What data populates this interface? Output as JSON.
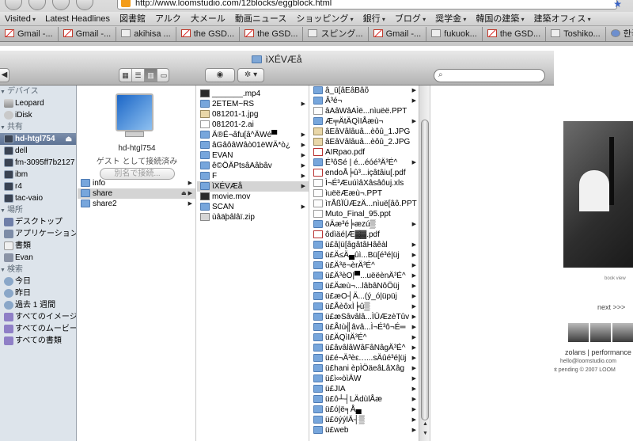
{
  "browser": {
    "url": "http://www.loomstudio.com/12blocks/eggblock.html",
    "bookmarks": [
      {
        "label": "Visited",
        "has_menu": true
      },
      {
        "label": "Latest Headlines",
        "has_menu": false
      },
      {
        "label": "図書館",
        "has_menu": false
      },
      {
        "label": "アルク",
        "has_menu": false
      },
      {
        "label": "大メール",
        "has_menu": false
      },
      {
        "label": "動画ニュース",
        "has_menu": false
      },
      {
        "label": "ショッピング",
        "has_menu": true
      },
      {
        "label": "銀行",
        "has_menu": true
      },
      {
        "label": "ブログ",
        "has_menu": true
      },
      {
        "label": "奨学金",
        "has_menu": true
      },
      {
        "label": "韓国の建築",
        "has_menu": true
      },
      {
        "label": "建築オフィス",
        "has_menu": true
      }
    ],
    "tabs": [
      {
        "label": "Gmail -...",
        "icon": "gmail-icon"
      },
      {
        "label": "Gmail -...",
        "icon": "gmail-icon"
      },
      {
        "label": "akihisa ...",
        "icon": "document-icon"
      },
      {
        "label": "the GSD...",
        "icon": "gmail-icon"
      },
      {
        "label": "the GSD...",
        "icon": "gmail-icon"
      },
      {
        "label": "スピング...",
        "icon": "document-icon"
      },
      {
        "label": "Gmail -...",
        "icon": "gmail-icon"
      },
      {
        "label": "fukuok...",
        "icon": "document-icon"
      },
      {
        "label": "the GSD...",
        "icon": "gmail-icon"
      },
      {
        "label": "Toshiko...",
        "icon": "document-icon"
      },
      {
        "label": "한국어",
        "icon": "globe-icon"
      }
    ]
  },
  "page": {
    "book_view": "book view",
    "next_link": "next >>>",
    "caption_line1": "zolans | performance",
    "caption_line2": "hello@loomstudio.com",
    "caption_line3": "nt pending © 2007 LOOM"
  },
  "finder": {
    "title": "ìXÉVÆå",
    "sidebar": {
      "sections": [
        {
          "heading": "デバイス",
          "items": [
            {
              "label": "Leopard",
              "icon": "hard-disk-icon",
              "selected": false
            },
            {
              "label": "iDisk",
              "icon": "idisk-icon",
              "selected": false
            }
          ]
        },
        {
          "heading": "共有",
          "items": [
            {
              "label": "hd-htgl754",
              "icon": "server-icon",
              "selected": true,
              "eject": true
            },
            {
              "label": "dell",
              "icon": "server-icon",
              "selected": false
            },
            {
              "label": "fm-3095ff7b2127",
              "icon": "server-icon",
              "selected": false
            },
            {
              "label": "ibm",
              "icon": "server-icon",
              "selected": false
            },
            {
              "label": "r4",
              "icon": "server-icon",
              "selected": false
            },
            {
              "label": "tac-vaio",
              "icon": "server-icon",
              "selected": false
            }
          ]
        },
        {
          "heading": "場所",
          "items": [
            {
              "label": "デスクトップ",
              "icon": "desktop-icon",
              "selected": false
            },
            {
              "label": "アプリケーション",
              "icon": "applications-icon",
              "selected": false
            },
            {
              "label": "書類",
              "icon": "documents-icon",
              "selected": false
            },
            {
              "label": "Evan",
              "icon": "home-icon",
              "selected": false
            }
          ]
        },
        {
          "heading": "検索",
          "items": [
            {
              "label": "今日",
              "icon": "clock-icon",
              "selected": false
            },
            {
              "label": "昨日",
              "icon": "clock-icon",
              "selected": false
            },
            {
              "label": "過去 1 週間",
              "icon": "clock-icon",
              "selected": false
            },
            {
              "label": "すべてのイメージ",
              "icon": "smart-folder-icon",
              "selected": false
            },
            {
              "label": "すべてのムービー",
              "icon": "smart-folder-icon",
              "selected": false
            },
            {
              "label": "すべての書類",
              "icon": "smart-folder-icon",
              "selected": false
            }
          ]
        }
      ]
    },
    "server": {
      "name": "hd-htgl754",
      "status": "ゲスト として接続済み",
      "connect_button": "別名で接続..."
    },
    "share_items": [
      {
        "label": "info",
        "kind": "folder",
        "selected": false,
        "arrow": true
      },
      {
        "label": "share",
        "kind": "folder",
        "selected": true,
        "arrow": true,
        "eject": true
      },
      {
        "label": "share2",
        "kind": "folder",
        "selected": false,
        "arrow": true
      }
    ],
    "list_items": [
      {
        "label": "_______.mp4",
        "kind": "movie",
        "arrow": false,
        "selected": false
      },
      {
        "label": "2ETEM~RS",
        "kind": "folder",
        "arrow": true,
        "selected": false
      },
      {
        "label": "081201-1.jpg",
        "kind": "image",
        "arrow": false,
        "selected": false
      },
      {
        "label": "081201-2.ai",
        "kind": "file",
        "arrow": false,
        "selected": false
      },
      {
        "label": "Ä®É¬âfu[â^ÄWé▀",
        "kind": "folder",
        "arrow": true,
        "selected": false
      },
      {
        "label": "âGâôâWâò01ëWÄ*ò¿",
        "kind": "folder",
        "arrow": true,
        "selected": false
      },
      {
        "label": "EVAN",
        "kind": "folder",
        "arrow": true,
        "selected": false
      },
      {
        "label": "ê©ÖÄPtsâAâbâv",
        "kind": "folder",
        "arrow": true,
        "selected": false
      },
      {
        "label": "F",
        "kind": "folder",
        "arrow": true,
        "selected": false
      },
      {
        "label": "ìXÉVÆå",
        "kind": "folder",
        "arrow": true,
        "selected": true
      },
      {
        "label": "movie.mov",
        "kind": "movie",
        "arrow": false,
        "selected": false
      },
      {
        "label": "SCAN",
        "kind": "folder",
        "arrow": true,
        "selected": false
      },
      {
        "label": "ùâäþâlâï.zip",
        "kind": "zip",
        "arrow": false,
        "selected": false
      }
    ],
    "file_items": [
      {
        "label": "â_ü[âEâBâõ",
        "kind": "folder",
        "arrow": true
      },
      {
        "label": "Â³é¬",
        "kind": "folder",
        "arrow": true
      },
      {
        "label": "âAâWâAÌë...nìuëë.PPT",
        "kind": "file",
        "arrow": false
      },
      {
        "label": "Æ╤ÄtÄQìIÅæù¬",
        "kind": "folder",
        "arrow": true
      },
      {
        "label": "âEâVâlâuâ...èôû_1.JPG",
        "kind": "image",
        "arrow": false
      },
      {
        "label": "âEâVâlâuâ...èôû_2.JPG",
        "kind": "image",
        "arrow": false
      },
      {
        "label": "AIRpao.pdf",
        "kind": "pdf",
        "arrow": false
      },
      {
        "label": "É³ôSé | é...éóé³Ä³É^",
        "kind": "folder",
        "arrow": true
      },
      {
        "label": "endoÅ╞û³...içâtâiu[.pdf",
        "kind": "pdf",
        "arrow": false
      },
      {
        "label": "Ì¬É³Æuúì­âXâsâôuj.xls",
        "kind": "file",
        "arrow": false
      },
      {
        "label": "ìuëëÆæù¬.PPT",
        "kind": "file",
        "arrow": false
      },
      {
        "label": "ìᴛÅßÏÜÆzÄ...nìuë[âô.PPT",
        "kind": "file",
        "arrow": false
      },
      {
        "label": "Muto_Final_95.ppt",
        "kind": "file",
        "arrow": false
      },
      {
        "label": "öÄæ³é╞æzú▒",
        "kind": "folder",
        "arrow": true
      },
      {
        "label": "ôdìäé|Æ▓▓.pdf",
        "kind": "pdf",
        "arrow": false
      },
      {
        "label": "ü£â|ü[âgâtâHâêàl",
        "kind": "folder",
        "arrow": true
      },
      {
        "label": "ü£Ä≤Ä▄ûì...Bü[é³é|üj",
        "kind": "folder",
        "arrow": true
      },
      {
        "label": "ü£Ä³ë¬èrÄ³É^",
        "kind": "folder",
        "arrow": true
      },
      {
        "label": "ü£Ä³èO|▀...uëëènÄ³É^",
        "kind": "folder",
        "arrow": true
      },
      {
        "label": "ü£Äæù¬...lâbâNôÖüj",
        "kind": "folder",
        "arrow": true
      },
      {
        "label": "ü£æO┤Ä...(ý_ó|üpüj",
        "kind": "folder",
        "arrow": true
      },
      {
        "label": "ü£ÅèôxÌ╞û▒",
        "kind": "folder",
        "arrow": true
      },
      {
        "label": "ü£æSâvâlâ...ÌÜÆzèTûv",
        "kind": "folder",
        "arrow": true
      },
      {
        "label": "ü£ÅIù╣âvâ...Ì¬É³ô¬É═",
        "kind": "folder",
        "arrow": true
      },
      {
        "label": "ü£ÄQìIÄ³É^",
        "kind": "folder",
        "arrow": true
      },
      {
        "label": "ü£âvâlâWâFâNâgÄ³É^",
        "kind": "folder",
        "arrow": true
      },
      {
        "label": "ü£é¬Ä³èε.‥...sÄûé³é|üj",
        "kind": "folder",
        "arrow": true
      },
      {
        "label": "ü£hani èpÌÖäeâLâXâg",
        "kind": "folder",
        "arrow": true
      },
      {
        "label": "ü£ì∞òìÄW",
        "kind": "folder",
        "arrow": true
      },
      {
        "label": "ü£JIA",
        "kind": "folder",
        "arrow": true
      },
      {
        "label": "ü£ô┴┤LÄdùlÅæ",
        "kind": "folder",
        "arrow": true
      },
      {
        "label": "ü£ó|ë╕Å▄",
        "kind": "folder",
        "arrow": true
      },
      {
        "label": "ü£öýýlÄ┤▒",
        "kind": "folder",
        "arrow": true
      },
      {
        "label": "ü£web",
        "kind": "folder",
        "arrow": true
      }
    ]
  }
}
